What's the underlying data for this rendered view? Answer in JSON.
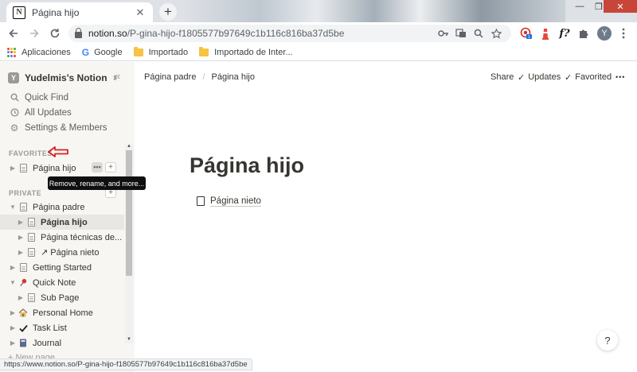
{
  "browser": {
    "tab_title": "Página hijo",
    "tab_favicon": "N",
    "tab_close": "✕",
    "new_tab": "+",
    "url_host": "notion.so",
    "url_path": "/P-gina-hijo-f1805577b97649c1b116c816ba37d5be",
    "profile_initial": "Y",
    "extension_badge": "1",
    "ext_f_label": "f?",
    "window_controls": {
      "minimize": "—",
      "maximize": "❐",
      "close": "✕"
    },
    "bookmarks": [
      {
        "label": "Aplicaciones",
        "icon": "apps-grid-icon"
      },
      {
        "label": "Google",
        "icon": "google-icon"
      },
      {
        "label": "Importado",
        "icon": "folder-icon"
      },
      {
        "label": "Importado de Inter...",
        "icon": "folder-icon"
      }
    ],
    "status_url": "https://www.notion.so/P-gina-hijo-f1805577b97649c1b116c816ba37d5be"
  },
  "sidebar": {
    "workspace_icon": "Y",
    "workspace_name": "Yudelmis's Notion",
    "nav": [
      {
        "label": "Quick Find",
        "icon": "search-icon"
      },
      {
        "label": "All Updates",
        "icon": "clock-icon"
      },
      {
        "label": "Settings & Members",
        "icon": "gear-icon"
      }
    ],
    "favorites_label": "FAVORITES",
    "favorites": [
      {
        "label": "Página hijo"
      }
    ],
    "tooltip": "Remove, rename, and more...",
    "private_label": "PRIVATE",
    "private": [
      {
        "label": "Página padre",
        "expanded": true,
        "level": 0,
        "icon": "page"
      },
      {
        "label": "Página hijo",
        "level": 1,
        "icon": "page",
        "active": true
      },
      {
        "label": "Página técnicas de...",
        "level": 1,
        "icon": "page"
      },
      {
        "label": "Página nieto",
        "level": 1,
        "icon": "link-page"
      },
      {
        "label": "Getting Started",
        "level": 0,
        "icon": "page"
      },
      {
        "label": "Quick Note",
        "expanded": true,
        "level": 0,
        "icon": "pin"
      },
      {
        "label": "Sub Page",
        "level": 1,
        "icon": "page"
      },
      {
        "label": "Personal Home",
        "level": 0,
        "icon": "house"
      },
      {
        "label": "Task List",
        "level": 0,
        "icon": "check"
      },
      {
        "label": "Journal",
        "level": 0,
        "icon": "notebook"
      }
    ],
    "new_page": "+ New page"
  },
  "topbar": {
    "breadcrumb": [
      "Página padre",
      "Página hijo"
    ],
    "share": "Share",
    "updates": "Updates",
    "favorited": "Favorited",
    "more": "•••"
  },
  "page": {
    "title": "Página hijo",
    "subpages": [
      {
        "label": "Página nieto"
      }
    ]
  },
  "help_label": "?",
  "colors": {
    "sidebar_bg": "#f7f6f3",
    "text": "#37352f",
    "annotation_arrow": "#d92323"
  }
}
